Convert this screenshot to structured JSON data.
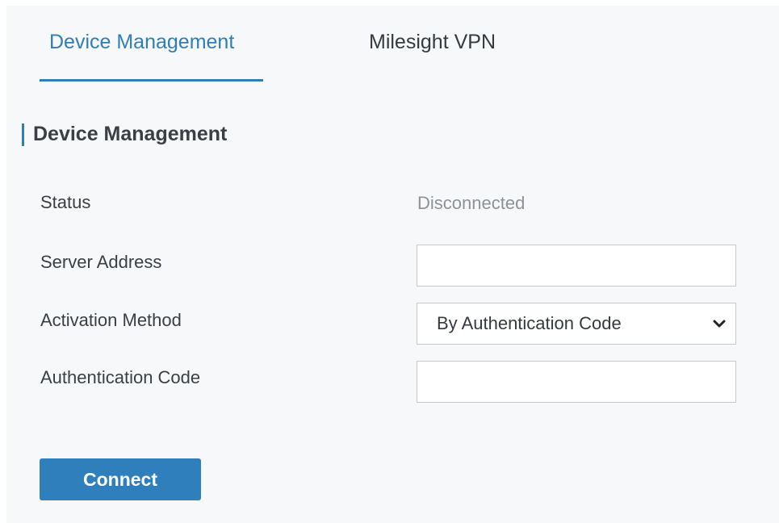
{
  "tabs": [
    {
      "label": "Device Management",
      "active": true
    },
    {
      "label": "Milesight VPN",
      "active": false
    }
  ],
  "section": {
    "title": "Device Management"
  },
  "form": {
    "status_label": "Status",
    "status_value": "Disconnected",
    "server_address_label": "Server Address",
    "server_address_value": "",
    "activation_method_label": "Activation Method",
    "activation_method_value": "By Authentication Code",
    "authentication_code_label": "Authentication Code",
    "authentication_code_value": ""
  },
  "actions": {
    "connect_label": "Connect"
  },
  "colors": {
    "accent": "#2f7fb6",
    "button": "#2f7fbd",
    "text": "#3a3f45",
    "muted": "#8d9298",
    "background": "#f7f8f9"
  },
  "icons": {
    "select_chevron": "chevron-down-icon"
  }
}
